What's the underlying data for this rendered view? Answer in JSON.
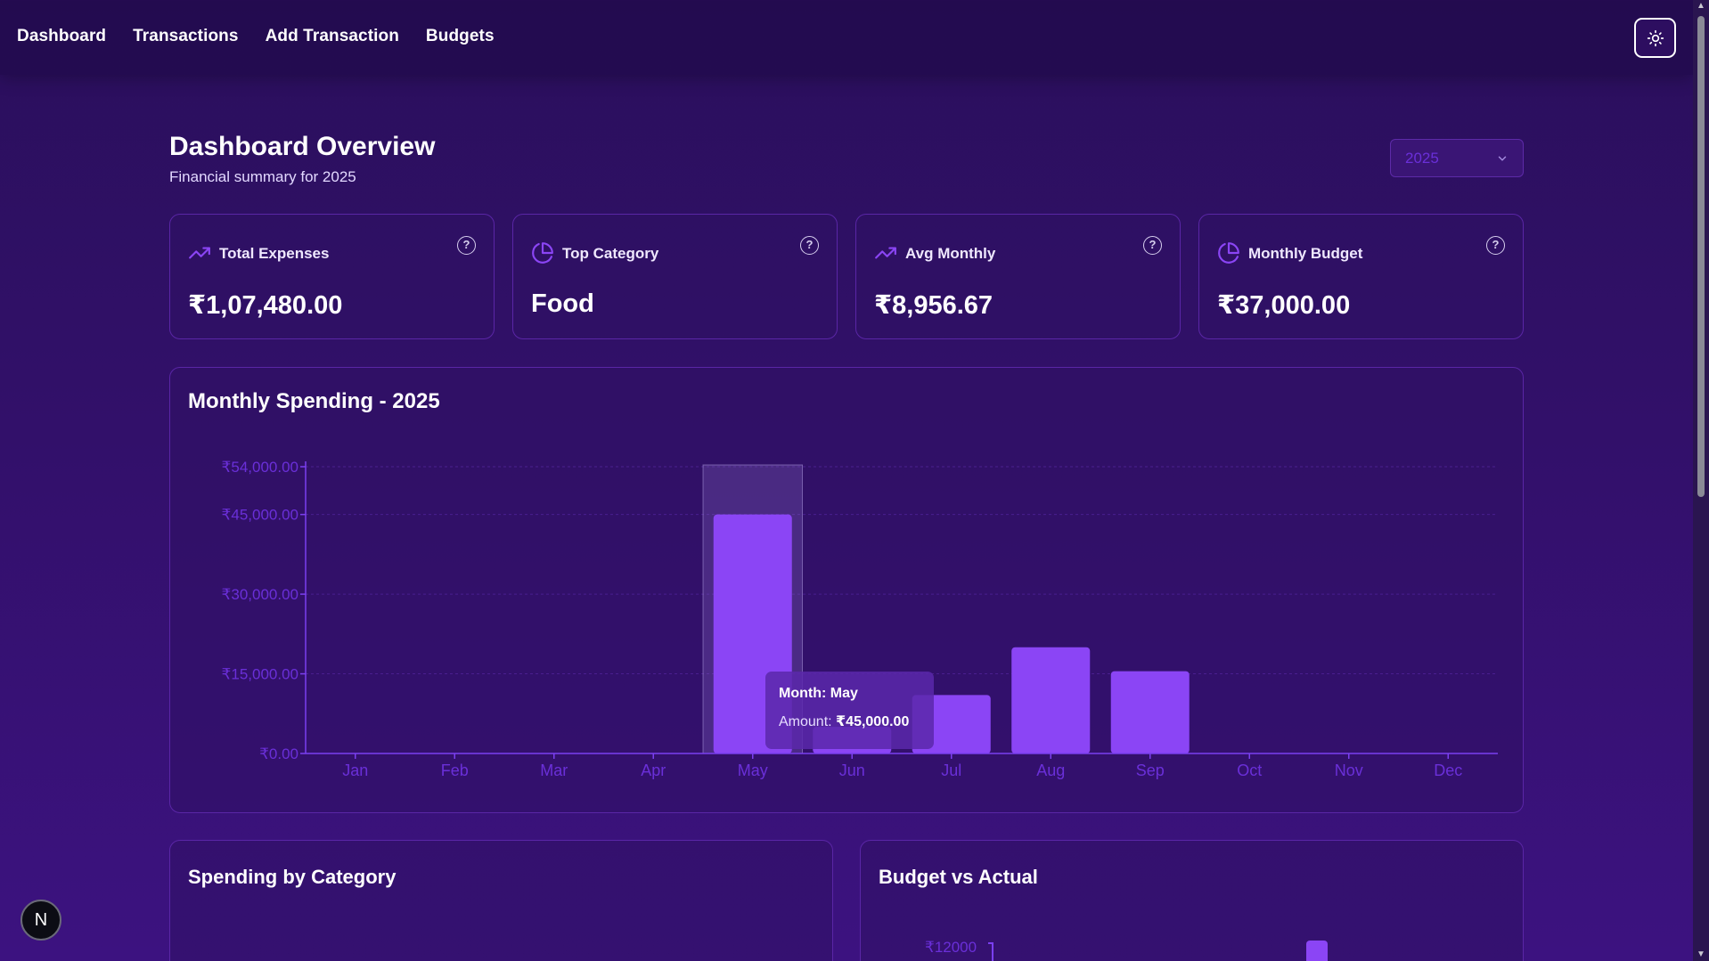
{
  "nav": {
    "items": [
      "Dashboard",
      "Transactions",
      "Add Transaction",
      "Budgets"
    ]
  },
  "theme_toggle_icon": "sun-icon",
  "header": {
    "title": "Dashboard Overview",
    "subtitle": "Financial summary for 2025",
    "year_select": {
      "value": "2025",
      "icon": "chevron-down-icon"
    }
  },
  "stats": [
    {
      "label": "Total Expenses",
      "value": "₹1,07,480.00",
      "icon": "trending-up-icon"
    },
    {
      "label": "Top Category",
      "value": "Food",
      "icon": "pie-chart-icon"
    },
    {
      "label": "Avg Monthly",
      "value": "₹8,956.67",
      "icon": "trending-up-icon"
    },
    {
      "label": "Monthly Budget",
      "value": "₹37,000.00",
      "icon": "pie-chart-icon"
    }
  ],
  "help_icon": "help-circle-icon",
  "monthly_chart": {
    "title": "Monthly Spending - 2025",
    "tooltip": {
      "month_label": "Month: May",
      "amount_prefix": "Amount: ",
      "amount_value": "₹45,000.00"
    }
  },
  "chart_data": {
    "type": "bar",
    "title": "Monthly Spending - 2025",
    "categories": [
      "Jan",
      "Feb",
      "Mar",
      "Apr",
      "May",
      "Jun",
      "Jul",
      "Aug",
      "Sep",
      "Oct",
      "Nov",
      "Dec"
    ],
    "values": [
      0,
      0,
      0,
      0,
      45000,
      5000,
      11000,
      20000,
      15500,
      0,
      0,
      0
    ],
    "ytick_values": [
      0,
      15000,
      30000,
      45000,
      54000
    ],
    "ytick_labels": [
      "₹0.00",
      "₹15,000.00",
      "₹30,000.00",
      "₹45,000.00",
      "₹54,000.00"
    ],
    "ylim": [
      0,
      54000
    ],
    "highlighted_category": "May",
    "grid": true,
    "colors": {
      "bar": "#8b45f5",
      "axis": "#7b3ff0",
      "tick_text": "#6a2fd8"
    }
  },
  "category_card": {
    "title": "Spending by Category"
  },
  "budget_card": {
    "title": "Budget vs Actual",
    "first_tick": "₹12000"
  },
  "badge": {
    "letter": "N"
  }
}
